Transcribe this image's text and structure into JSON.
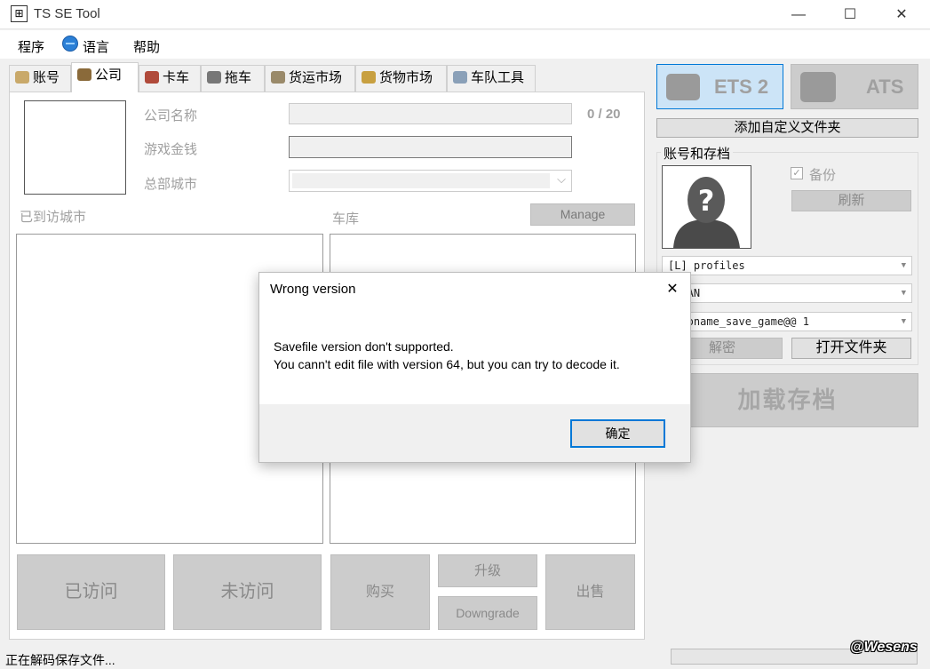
{
  "window": {
    "title": "TS SE Tool",
    "minimize": "—",
    "maximize": "☐",
    "close": "✕"
  },
  "menu": {
    "program": "程序",
    "language": "语言",
    "help": "帮助"
  },
  "tabs": [
    "账号",
    "公司",
    "卡车",
    "拖车",
    "货运市场",
    "货物市场",
    "车队工具"
  ],
  "company": {
    "name_label": "公司名称",
    "name_counter": "0 / 20",
    "money_label": "游戏金钱",
    "hq_label": "总部城市",
    "visited_label": "已到访城市",
    "garage_label": "车库",
    "manage_btn": "Manage",
    "btn_visited": "已访问",
    "btn_unvisited": "未访问",
    "btn_buy": "购买",
    "btn_upgrade": "升级",
    "btn_downgrade": "Downgrade",
    "btn_sell": "出售"
  },
  "right": {
    "ets2": "ETS 2",
    "ats": "ATS",
    "add_folder": "添加自定义文件夹",
    "group_title": "账号和存档",
    "backup_label": "备份",
    "refresh_btn": "刷新",
    "profile_combo": "[L] profiles",
    "user_combo": "ZSFAN",
    "save_combo": "@@noname_save_game@@ 1",
    "decode_btn": "解密",
    "open_folder_btn": "打开文件夹",
    "load_btn": "加载存档"
  },
  "status": {
    "text": "正在解码保存文件..."
  },
  "watermark": "@Wesens",
  "dialog": {
    "title": "Wrong version",
    "close": "✕",
    "line1": "Savefile version don't supported.",
    "line2": "You cann't edit file with version 64, but you can try to decode it.",
    "ok": "确定"
  },
  "colors": {
    "accent": "#0078d7",
    "tab_selected_bg": "#cce4f7",
    "disabled_btn": "#cccccc"
  }
}
